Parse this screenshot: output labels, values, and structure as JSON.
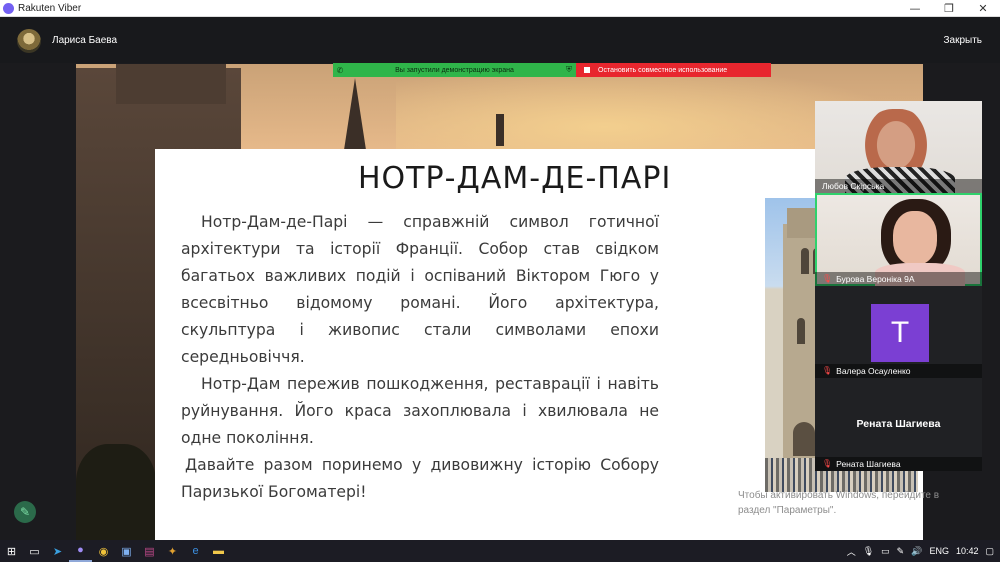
{
  "window": {
    "title": "Rakuten Viber",
    "controls": [
      "—",
      "❐",
      "✕"
    ]
  },
  "call": {
    "caller_name": "Лариса Баева",
    "close_label": "Закрыть"
  },
  "screen_share": {
    "active_text": "Вы запустили демонстрацию экрана",
    "stop_text": "Остановить совместное использование"
  },
  "slide": {
    "title": "НОТР-ДАМ-ДЕ-ПАРІ",
    "paragraphs": [
      "Нотр-Дам-де-Парі — справжній символ готичної архітектури та історії Франції. Собор став свідком багатьох важливих подій і оспіваний Віктором Гюго у всесвітньо відомому романі. Його архітектура, скульптура і живопис стали символами епохи середньовіччя.",
      "Нотр-Дам пережив пошкодження, реставрації і навіть руйнування. Його краса захоплювала і хвилювала не одне покоління.",
      "Давайте разом поринемо у дивовижну історію Собору Паризької Богоматері!"
    ]
  },
  "watermark": {
    "line1": "Чтобы активировать Windows, перейдите в",
    "line2": "раздел \"Параметры\"."
  },
  "participants": [
    {
      "name": "Любов Скірська",
      "muted": false
    },
    {
      "name": "Бурова Вероніка 9А",
      "muted": true
    },
    {
      "name": "Валера Осауленко",
      "muted": true,
      "initial": "T"
    },
    {
      "name": "Рената Шагиева",
      "muted": true,
      "display_name": "Рената Шагиева"
    }
  ],
  "taskbar": {
    "language": "ENG",
    "time": "10:42"
  },
  "colors": {
    "share_green": "#2fb54a",
    "stop_red": "#e8262e",
    "viber_purple": "#7360f2",
    "active_speaker": "#2fd16c"
  }
}
